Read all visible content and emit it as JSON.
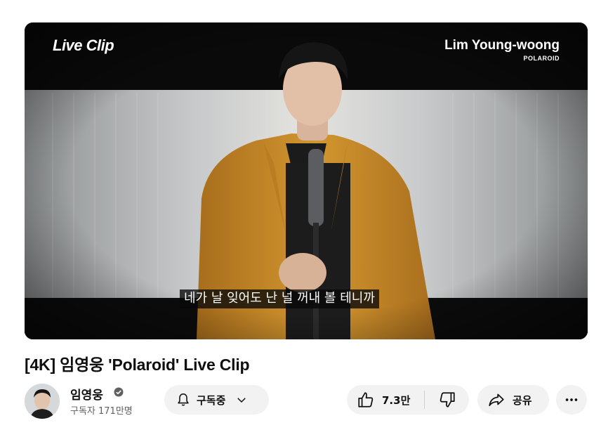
{
  "player": {
    "logo_left": "Live Clip",
    "logo_right_title": "Lim Young-woong",
    "logo_right_sub": "POLAROID",
    "subtitle": "네가 날 잊어도 난 널 꺼내 볼 테니까"
  },
  "video": {
    "title": "[4K] 임영웅 'Polaroid' Live Clip"
  },
  "channel": {
    "name": "임영웅",
    "subscribers": "구독자 171만명",
    "verified_icon": "verified-badge-icon"
  },
  "actions": {
    "subscribe_label": "구독중",
    "like_count": "7.3만",
    "share_label": "공유"
  },
  "colors": {
    "pill_bg": "#f2f2f2",
    "jacket": "#c98a2a",
    "subtitle_bg": "#080808"
  }
}
